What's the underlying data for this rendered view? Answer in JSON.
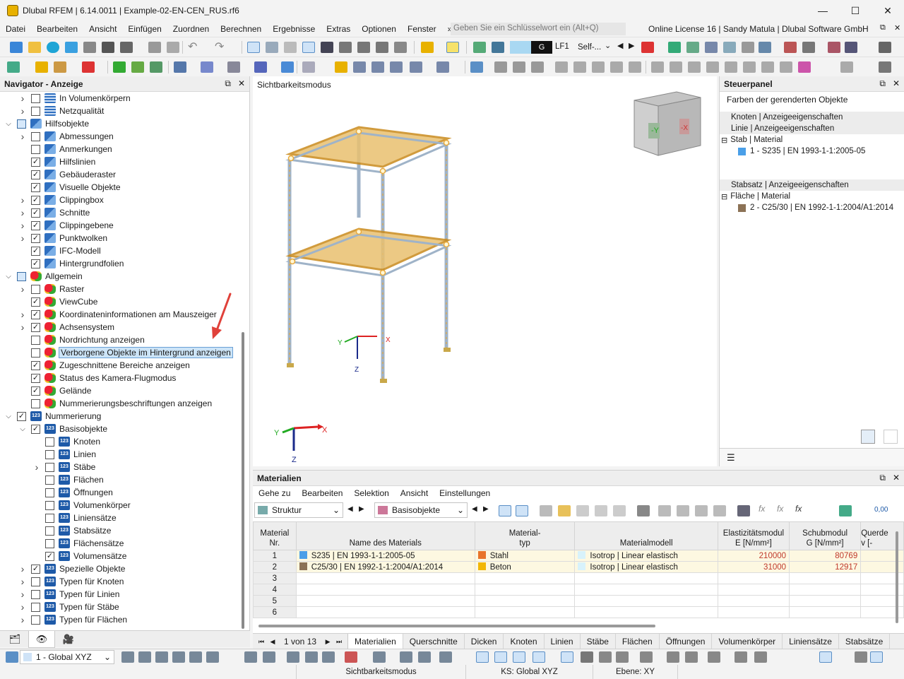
{
  "window": {
    "title": "Dlubal RFEM | 6.14.0011 | Example-02-EN-CEN_RUS.rf6"
  },
  "menu": {
    "items": [
      "Datei",
      "Bearbeiten",
      "Ansicht",
      "Einfügen",
      "Zuordnen",
      "Berechnen",
      "Ergebnisse",
      "Extras",
      "Optionen",
      "Fenster"
    ],
    "overflow": "»",
    "search_placeholder": "Geben Sie ein Schlüsselwort ein (Alt+Q)",
    "license": "Online License 16 | Sandy Matula | Dlubal Software GmbH"
  },
  "toolbar": {
    "load_case_code": "G",
    "load_case": "LF1",
    "load_case_desc": "Self-..."
  },
  "navigator": {
    "title": "Navigator - Anzeige",
    "items": [
      {
        "label": "In Volumenkörpern",
        "checked": false,
        "level": 1,
        "expander": true,
        "icon": "grid"
      },
      {
        "label": "Netzqualität",
        "checked": false,
        "level": 1,
        "expander": true,
        "icon": "grid"
      },
      {
        "label": "Hilfsobjekte",
        "checked": "partial",
        "level": 0,
        "expander": "open",
        "icon": "blue"
      },
      {
        "label": "Abmessungen",
        "checked": false,
        "level": 1,
        "expander": true,
        "icon": "blue"
      },
      {
        "label": "Anmerkungen",
        "checked": false,
        "level": 1,
        "expander": false,
        "icon": "blue"
      },
      {
        "label": "Hilfslinien",
        "checked": true,
        "level": 1,
        "expander": false,
        "icon": "blue"
      },
      {
        "label": "Gebäuderaster",
        "checked": true,
        "level": 1,
        "expander": false,
        "icon": "blue"
      },
      {
        "label": "Visuelle Objekte",
        "checked": true,
        "level": 1,
        "expander": false,
        "icon": "blue"
      },
      {
        "label": "Clippingbox",
        "checked": true,
        "level": 1,
        "expander": true,
        "icon": "blue"
      },
      {
        "label": "Schnitte",
        "checked": true,
        "level": 1,
        "expander": true,
        "icon": "blue"
      },
      {
        "label": "Clippingebene",
        "checked": true,
        "level": 1,
        "expander": true,
        "icon": "blue"
      },
      {
        "label": "Punktwolken",
        "checked": true,
        "level": 1,
        "expander": true,
        "icon": "blue"
      },
      {
        "label": "IFC-Modell",
        "checked": true,
        "level": 1,
        "expander": false,
        "icon": "blue"
      },
      {
        "label": "Hintergrundfolien",
        "checked": true,
        "level": 1,
        "expander": false,
        "icon": "blue"
      },
      {
        "label": "Allgemein",
        "checked": "partial",
        "level": 0,
        "expander": "open",
        "icon": "heart"
      },
      {
        "label": "Raster",
        "checked": false,
        "level": 1,
        "expander": true,
        "icon": "heart"
      },
      {
        "label": "ViewCube",
        "checked": true,
        "level": 1,
        "expander": false,
        "icon": "heart"
      },
      {
        "label": "Koordinateninformationen am Mauszeiger",
        "checked": true,
        "level": 1,
        "expander": true,
        "icon": "heart"
      },
      {
        "label": "Achsensystem",
        "checked": true,
        "level": 1,
        "expander": true,
        "icon": "heart"
      },
      {
        "label": "Nordrichtung anzeigen",
        "checked": false,
        "level": 1,
        "expander": false,
        "icon": "heart"
      },
      {
        "label": "Verborgene Objekte im Hintergrund anzeigen",
        "checked": false,
        "level": 1,
        "expander": false,
        "icon": "heart",
        "selected": true
      },
      {
        "label": "Zugeschnittene Bereiche anzeigen",
        "checked": true,
        "level": 1,
        "expander": false,
        "icon": "heart"
      },
      {
        "label": "Status des Kamera-Flugmodus",
        "checked": true,
        "level": 1,
        "expander": false,
        "icon": "heart"
      },
      {
        "label": "Gelände",
        "checked": true,
        "level": 1,
        "expander": false,
        "icon": "heart"
      },
      {
        "label": "Nummerierungsbeschriftungen anzeigen",
        "checked": false,
        "level": 1,
        "expander": false,
        "icon": "heart"
      },
      {
        "label": "Nummerierung",
        "checked": true,
        "level": 0,
        "expander": "open",
        "icon": "num"
      },
      {
        "label": "Basisobjekte",
        "checked": true,
        "level": 1,
        "expander": "open",
        "icon": "num"
      },
      {
        "label": "Knoten",
        "checked": false,
        "level": 2,
        "expander": false,
        "icon": "num"
      },
      {
        "label": "Linien",
        "checked": false,
        "level": 2,
        "expander": false,
        "icon": "num"
      },
      {
        "label": "Stäbe",
        "checked": false,
        "level": 2,
        "expander": true,
        "icon": "num"
      },
      {
        "label": "Flächen",
        "checked": false,
        "level": 2,
        "expander": false,
        "icon": "num"
      },
      {
        "label": "Öffnungen",
        "checked": false,
        "level": 2,
        "expander": false,
        "icon": "num"
      },
      {
        "label": "Volumenkörper",
        "checked": false,
        "level": 2,
        "expander": false,
        "icon": "num"
      },
      {
        "label": "Liniensätze",
        "checked": false,
        "level": 2,
        "expander": false,
        "icon": "num"
      },
      {
        "label": "Stabsätze",
        "checked": false,
        "level": 2,
        "expander": false,
        "icon": "num"
      },
      {
        "label": "Flächensätze",
        "checked": false,
        "level": 2,
        "expander": false,
        "icon": "num"
      },
      {
        "label": "Volumensätze",
        "checked": true,
        "level": 2,
        "expander": false,
        "icon": "num"
      },
      {
        "label": "Spezielle Objekte",
        "checked": true,
        "level": 1,
        "expander": true,
        "icon": "num"
      },
      {
        "label": "Typen für Knoten",
        "checked": false,
        "level": 1,
        "expander": true,
        "icon": "num"
      },
      {
        "label": "Typen für Linien",
        "checked": false,
        "level": 1,
        "expander": true,
        "icon": "num"
      },
      {
        "label": "Typen für Stäbe",
        "checked": false,
        "level": 1,
        "expander": true,
        "icon": "num"
      },
      {
        "label": "Typen für Flächen",
        "checked": false,
        "level": 1,
        "expander": true,
        "icon": "num"
      }
    ]
  },
  "viewport": {
    "title": "Sichtbarkeitsmodus",
    "axes": {
      "x": "X",
      "y": "Y",
      "z": "Z"
    },
    "cube_labels": {
      "neg_y": "-Y",
      "neg_x": "-X"
    }
  },
  "steuerpanel": {
    "title": "Steuerpanel",
    "subtitle": "Farben der gerenderten Objekte",
    "rows": [
      {
        "text": "Knoten | Anzeigeeigenschaften",
        "type": "sec"
      },
      {
        "text": "Linie | Anzeigeeigenschaften",
        "type": "sec"
      },
      {
        "text": "Stab | Material",
        "type": "group"
      },
      {
        "text": "1 - S235 | EN 1993-1-1:2005-05",
        "type": "item",
        "color": "#4a9fe8"
      },
      {
        "text": "",
        "type": "blank"
      },
      {
        "text": "",
        "type": "blank"
      },
      {
        "text": "Stabsatz | Anzeigeeigenschaften",
        "type": "sec"
      },
      {
        "text": "Fläche | Material",
        "type": "group"
      },
      {
        "text": "2 - C25/30 | EN 1992-1-1:2004/A1:2014",
        "type": "item",
        "color": "#8c7256"
      }
    ]
  },
  "materials": {
    "title": "Materialien",
    "menu": [
      "Gehe zu",
      "Bearbeiten",
      "Selektion",
      "Ansicht",
      "Einstellungen"
    ],
    "combo1": "Struktur",
    "combo2": "Basisobjekte",
    "headers": {
      "nr": [
        "Material",
        "Nr."
      ],
      "name": "Name des Materials",
      "typ": [
        "Material-",
        "typ"
      ],
      "modell": "Materialmodell",
      "e": [
        "Elastizitätsmodul",
        "E [N/mm²]"
      ],
      "g": [
        "Schubmodul",
        "G [N/mm²]"
      ],
      "v": [
        "Querde",
        "v [-"
      ]
    },
    "rows": [
      {
        "nr": "1",
        "name": "S235 | EN 1993-1-1:2005-05",
        "name_color": "#4a9fe8",
        "typ": "Stahl",
        "typ_color": "#e8742a",
        "modell": "Isotrop | Linear elastisch",
        "e": "210000",
        "g": "80769"
      },
      {
        "nr": "2",
        "name": "C25/30 | EN 1992-1-1:2004/A1:2014",
        "name_color": "#8c7256",
        "typ": "Beton",
        "typ_color": "#f2b705",
        "modell": "Isotrop | Linear elastisch",
        "e": "31000",
        "g": "12917"
      },
      {
        "nr": "3"
      },
      {
        "nr": "4"
      },
      {
        "nr": "5"
      },
      {
        "nr": "6"
      }
    ],
    "pager": "1 von 13",
    "tabs": [
      "Materialien",
      "Querschnitte",
      "Dicken",
      "Knoten",
      "Linien",
      "Stäbe",
      "Flächen",
      "Öffnungen",
      "Volumenkörper",
      "Liniensätze",
      "Stabsätze"
    ]
  },
  "status": {
    "cs_select": "1 - Global XYZ",
    "mode": "Sichtbarkeitsmodus",
    "ks": "KS: Global XYZ",
    "ebene": "Ebene: XY"
  },
  "colors": {
    "accent": "#1e5aa8",
    "steel": "#f0b44a",
    "red_arrow": "#e0413a"
  }
}
